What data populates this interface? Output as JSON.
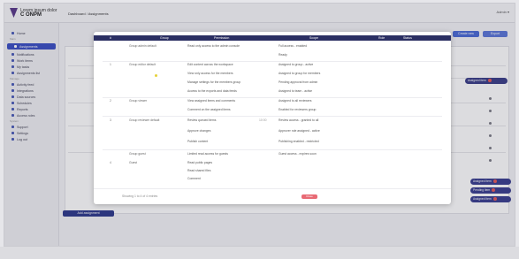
{
  "app": {
    "title": "C ONPM",
    "subtitle": "Lorem ipsum dolor",
    "breadcrumb_home": "Dashboard",
    "breadcrumb_current": "Assignments",
    "top_right": "Admin ▾"
  },
  "sidebar": {
    "items": [
      {
        "label": "Home"
      },
      {
        "label": "Assignments",
        "active": true
      },
      {
        "label": "Notifications"
      },
      {
        "label": "Work items"
      },
      {
        "label": "My tasks"
      },
      {
        "label": "Assignments list"
      },
      {
        "label": "Activity feed"
      },
      {
        "label": "Integrations"
      },
      {
        "label": "Data sources"
      },
      {
        "label": "Schedules"
      },
      {
        "label": "Reports"
      },
      {
        "label": "Access roles"
      },
      {
        "label": "Support"
      },
      {
        "label": "Settings"
      },
      {
        "label": "Log out"
      }
    ],
    "groups": [
      "Main",
      "Manage",
      "System"
    ]
  },
  "background": {
    "button_primary": "Create new",
    "button_secondary": "Export",
    "pills": [
      "Assigned item",
      "Assigned item",
      "Pending item",
      "Assigned item"
    ],
    "bottom_button": "Add assignment"
  },
  "modal": {
    "headers": [
      "#",
      "Group",
      "Permission",
      "Scope",
      "Role",
      "Status"
    ],
    "rows": [
      {
        "num": "",
        "group": "Group admin default",
        "perm": "Read only access to the admin console",
        "date": "",
        "result": "Full access - enabled"
      },
      {
        "num": "",
        "group": "",
        "perm": "",
        "date": "",
        "result": "Ready"
      },
      {
        "num": "1",
        "group": "Group editor default",
        "perm": "Edit content across the workspace",
        "date": "",
        "result": "Assigned to group - active"
      },
      {
        "num": "",
        "group": "",
        "perm": "View only access for the members",
        "date": "",
        "result": "Assigned to group for members"
      },
      {
        "num": "",
        "group": "",
        "perm": "Manage settings for the members group",
        "date": "",
        "result": "Pending approval from admin"
      },
      {
        "num": "",
        "group": "",
        "perm": "Access to the exports and data feeds",
        "date": "",
        "result": "Assigned to team - active"
      },
      {
        "num": "2",
        "group": "Group viewer",
        "perm": "View assigned items and comments",
        "date": "",
        "result": "Assigned to all reviewers"
      },
      {
        "num": "",
        "group": "",
        "perm": "Comment on the assigned items",
        "date": "",
        "result": "Enabled for reviewers group"
      },
      {
        "num": "3",
        "group": "Group reviewer default",
        "perm": "Review queued items",
        "date": "10:00",
        "result": "Review access - granted to all"
      },
      {
        "num": "",
        "group": "",
        "perm": "Approve changes",
        "date": "",
        "result": "Approver role assigned - active"
      },
      {
        "num": "",
        "group": "",
        "perm": "Publish content",
        "date": "",
        "result": "Publishing enabled - restricted"
      },
      {
        "num": "",
        "group": "Group guest",
        "perm": "Limited read access for guests",
        "date": "",
        "result": "Guest access - expires soon"
      },
      {
        "num": "4",
        "group": "Guest",
        "perm": "Read public pages",
        "date": "",
        "result": ""
      },
      {
        "num": "",
        "group": "",
        "perm": "Read shared files",
        "date": "",
        "result": ""
      },
      {
        "num": "",
        "group": "",
        "perm": "Comment",
        "date": "",
        "result": ""
      }
    ],
    "footer_count": "Showing 1 to 4 of 4 entries",
    "close_label": "Close"
  }
}
